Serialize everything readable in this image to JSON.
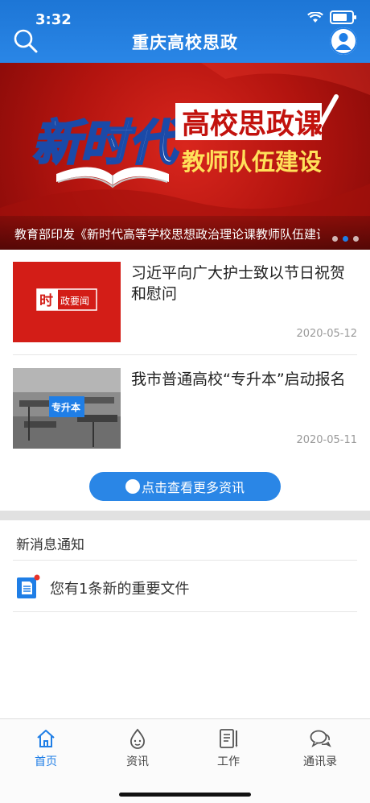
{
  "status_bar": {
    "time": "3:32"
  },
  "header": {
    "title": "重庆高校思政"
  },
  "banner": {
    "art_text_1": "新时代",
    "art_text_2": "高校思政课",
    "art_text_3": "教师队伍建设",
    "caption": "教育部印发《新时代高等学校思想政治理论课教师队伍建设规定》",
    "active_dot": 2
  },
  "news": [
    {
      "title": "习近平向广大护士致以节日祝贺和慰问",
      "date": "2020-05-12",
      "thumb_text": "时政要闻"
    },
    {
      "title": "我市普通高校“专升本”启动报名",
      "date": "2020-05-11",
      "thumb_text": "专升本"
    }
  ],
  "more_button": {
    "label": "点击查看更多资讯"
  },
  "notices": {
    "title": "新消息通知",
    "items": [
      {
        "text": "您有1条新的重要文件"
      }
    ]
  },
  "tabbar": {
    "tabs": [
      {
        "label": "首页",
        "icon": "home-icon",
        "active": true
      },
      {
        "label": "资讯",
        "icon": "droplet-icon",
        "active": false
      },
      {
        "label": "工作",
        "icon": "document-pen-icon",
        "active": false
      },
      {
        "label": "通讯录",
        "icon": "chat-icon",
        "active": false
      }
    ]
  },
  "colors": {
    "accent": "#1f7ee6",
    "banner_red": "#c81b14",
    "muted": "#999999"
  }
}
